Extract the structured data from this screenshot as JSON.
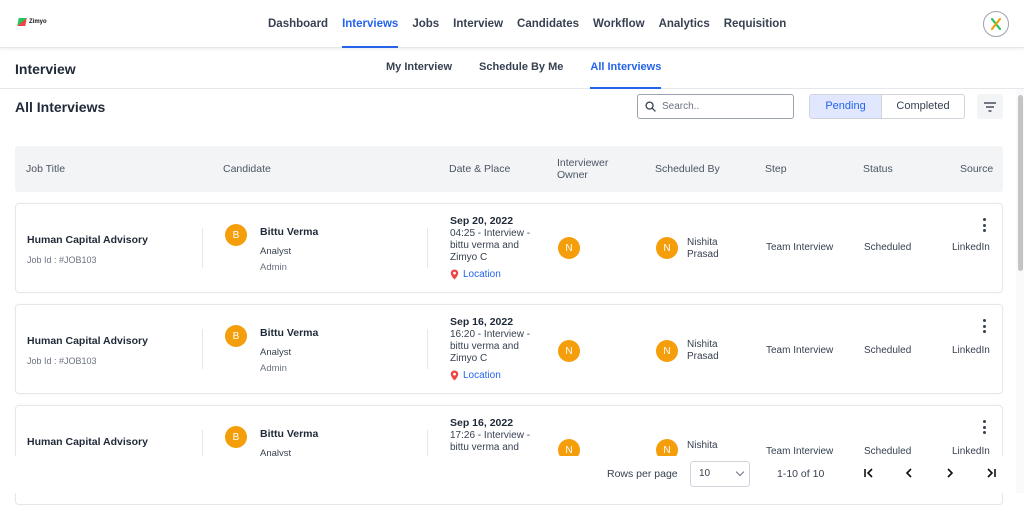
{
  "brand": {
    "name": "Zimyo"
  },
  "nav": {
    "items": [
      {
        "label": "Dashboard"
      },
      {
        "label": "Interviews"
      },
      {
        "label": "Jobs"
      },
      {
        "label": "Interview"
      },
      {
        "label": "Candidates"
      },
      {
        "label": "Workflow"
      },
      {
        "label": "Analytics"
      },
      {
        "label": "Requisition"
      }
    ],
    "active_index": 1
  },
  "page": {
    "title": "Interview",
    "tabs": [
      {
        "label": "My Interview"
      },
      {
        "label": "Schedule By Me"
      },
      {
        "label": "All Interviews"
      }
    ],
    "active_tab": 2
  },
  "toolbar": {
    "section_title": "All Interviews",
    "search_placeholder": "Search..",
    "pending_label": "Pending",
    "completed_label": "Completed"
  },
  "table": {
    "headers": {
      "job_title": "Job Title",
      "candidate": "Candidate",
      "date_place": "Date & Place",
      "interviewer_owner": "Interviewer Owner",
      "scheduled_by": "Scheduled By",
      "step": "Step",
      "status": "Status",
      "source": "Source"
    },
    "rows": [
      {
        "job_title": "Human Capital Advisory",
        "job_id": "Job Id : #JOB103",
        "candidate_initial": "B",
        "candidate_name": "Bittu Verma",
        "candidate_role": "Analyst",
        "candidate_sub": "Admin",
        "date": "Sep 20, 2022",
        "detail": "04:25 - Interview - bittu verma and Zimyo C",
        "location": "Location",
        "owner_initial": "N",
        "scheduler_initial": "N",
        "scheduler_name": "Nishita Prasad",
        "step": "Team Interview",
        "status": "Scheduled",
        "source": "LinkedIn"
      },
      {
        "job_title": "Human Capital Advisory",
        "job_id": "Job Id : #JOB103",
        "candidate_initial": "B",
        "candidate_name": "Bittu Verma",
        "candidate_role": "Analyst",
        "candidate_sub": "Admin",
        "date": "Sep 16, 2022",
        "detail": "16:20 - Interview - bittu verma and Zimyo C",
        "location": "Location",
        "owner_initial": "N",
        "scheduler_initial": "N",
        "scheduler_name": "Nishita Prasad",
        "step": "Team Interview",
        "status": "Scheduled",
        "source": "LinkedIn"
      },
      {
        "job_title": "Human Capital Advisory",
        "job_id": "",
        "candidate_initial": "B",
        "candidate_name": "Bittu Verma",
        "candidate_role": "Analyst",
        "candidate_sub": "",
        "date": "Sep 16, 2022",
        "detail": "17:26 - Interview - bittu verma and",
        "location": "",
        "owner_initial": "N",
        "scheduler_initial": "N",
        "scheduler_name": "Nishita",
        "step": "Team Interview",
        "status": "Scheduled",
        "source": "LinkedIn"
      }
    ]
  },
  "pagination": {
    "rows_per_page_label": "Rows per page",
    "rows_per_page_value": "10",
    "range": "1-10 of 10"
  },
  "colors": {
    "accent": "#2563eb",
    "avatar": "#f59e0b",
    "location_pin": "#ef4444"
  }
}
